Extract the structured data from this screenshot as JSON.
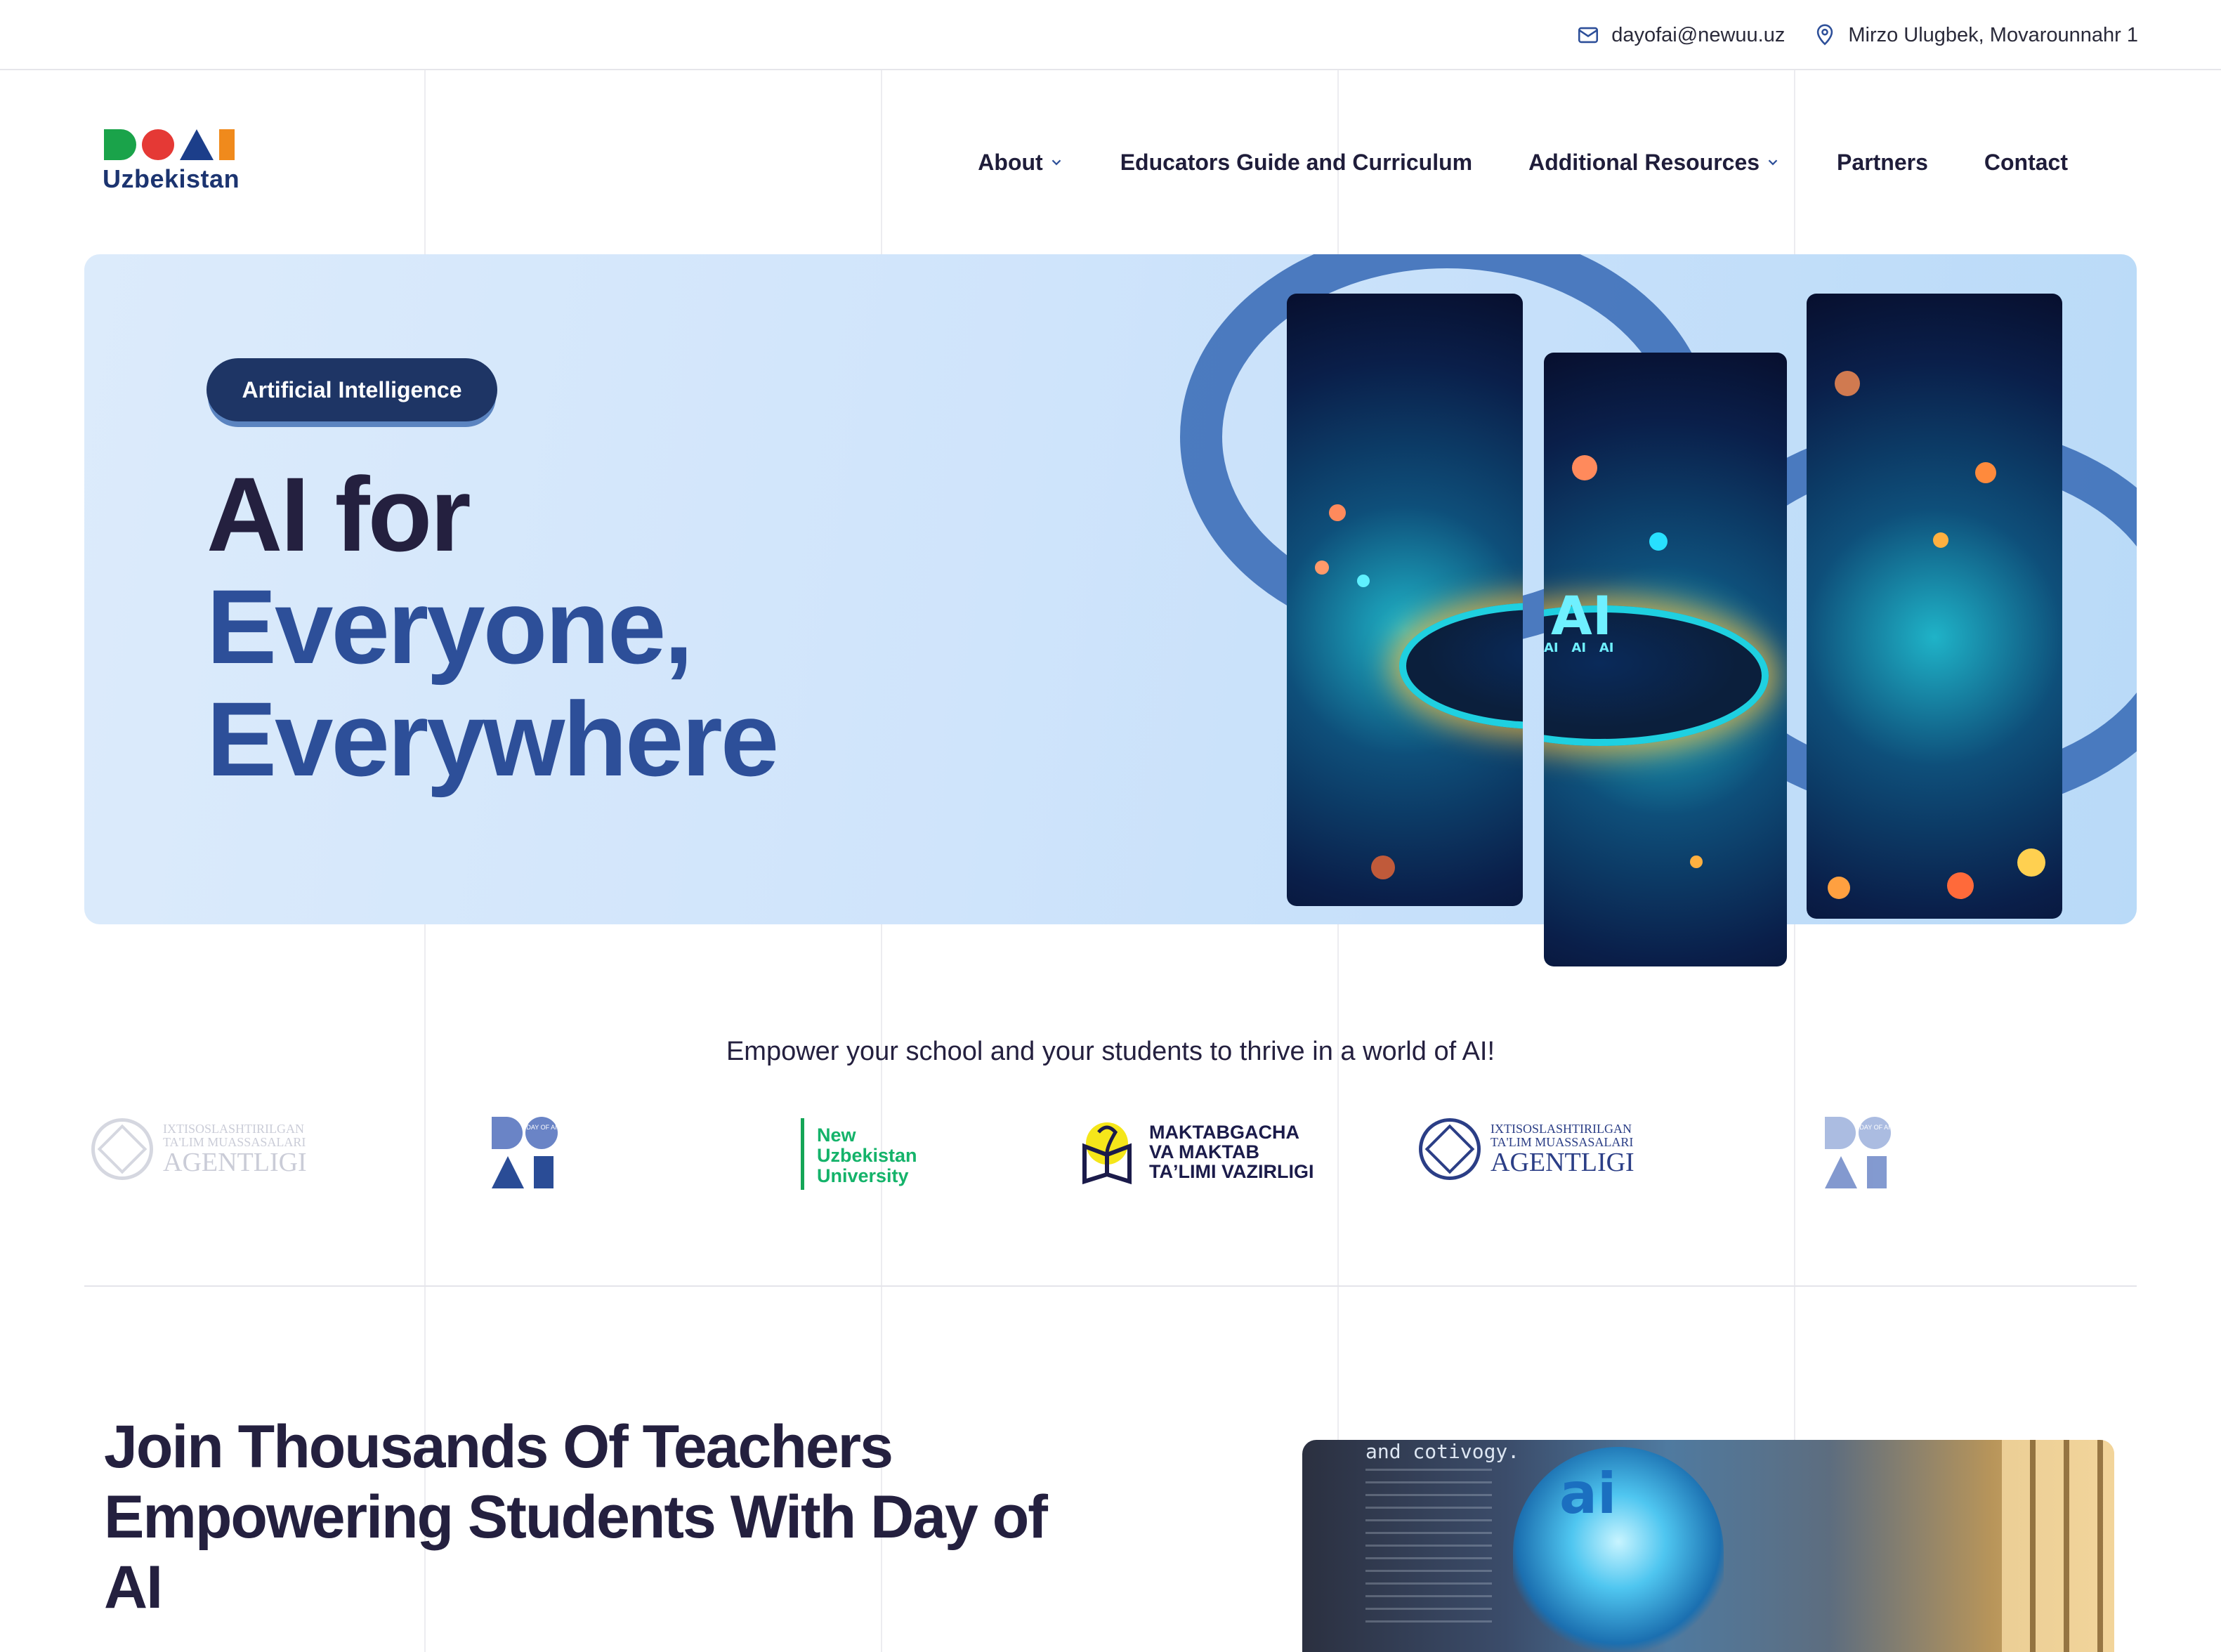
{
  "topbar": {
    "email": "dayofai@newuu.uz",
    "address": "Mirzo Ulugbek, Movarounnahr 1"
  },
  "logo": {
    "wordmark": "Uzbekistan",
    "colors": [
      "#1aa34a",
      "#e53935",
      "#1c3e8a",
      "#f08a1c"
    ]
  },
  "nav": {
    "items": [
      {
        "label": "About",
        "has_dropdown": true
      },
      {
        "label": "Educators Guide and Curriculum",
        "has_dropdown": false
      },
      {
        "label": "Additional Resources",
        "has_dropdown": true
      },
      {
        "label": "Partners",
        "has_dropdown": false
      },
      {
        "label": "Contact",
        "has_dropdown": false
      }
    ]
  },
  "hero": {
    "badge": "Artificial Intelligence",
    "title_line1": "AI for",
    "title_line2": "Everyone,",
    "title_line3": "Everywhere",
    "image_text": "AI",
    "image_subtext": "AI   AI   AI"
  },
  "partners": {
    "tagline": "Empower your school and your students to thrive in a world of AI!",
    "ixtisos_line1": "IXTISOSLASHTIRILGAN",
    "ixtisos_line2": "TA'LIM MUASSASALARI",
    "ixtisos_line3": "AGENTLIGI",
    "doai_small_text": "DAY OF AI",
    "nuu_line1": "New",
    "nuu_line2": "Uzbekistan",
    "nuu_line3": "University",
    "mak_line1": "MAKTABGACHA",
    "mak_line2": "VA MAKTAB",
    "mak_line3": "TAʼLIMI VAZIRLIGI"
  },
  "join": {
    "title": "Join Thousands Of Teachers Empowering Students With Day of AI",
    "image_chalk_text": "and cotivogy.",
    "image_ai_text": "ai"
  },
  "colors": {
    "hero_bg": "#cfe4fb",
    "dark_text": "#24203f",
    "accent_blue": "#2d4f99",
    "badge_bg": "#1e3565"
  }
}
